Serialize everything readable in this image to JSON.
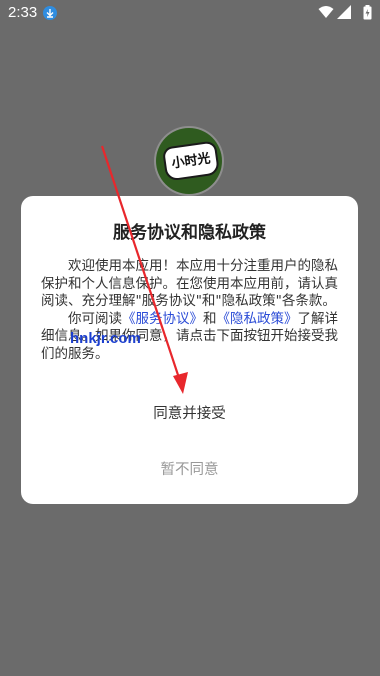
{
  "status_bar": {
    "time": "2:33",
    "icons": [
      "download-icon",
      "wifi-icon",
      "signal-icon",
      "battery-icon"
    ]
  },
  "app": {
    "logo_text": "小时光"
  },
  "dialog": {
    "title": "服务协议和隐私政策",
    "para1": "欢迎使用本应用！本应用十分注重用户的隐私保护和个人信息保护。在您使用本应用前，请认真阅读、充分理解\"服务协议\"和\"隐私政策\"各条款。",
    "para2_prefix": "你可阅读",
    "link_service": "《服务协议》",
    "para2_and": "和",
    "link_privacy": "《隐私政策》",
    "para2_suffix": "了解详细信息。如果你同意，请点击下面按钮开始接受我们的服务。",
    "agree_label": "同意并接受",
    "disagree_label": "暂不同意"
  },
  "watermark": "hnkjr.com",
  "colors": {
    "overlay": "#6b6b6b",
    "link": "#2a4bd6",
    "arrow": "#e8272c"
  }
}
